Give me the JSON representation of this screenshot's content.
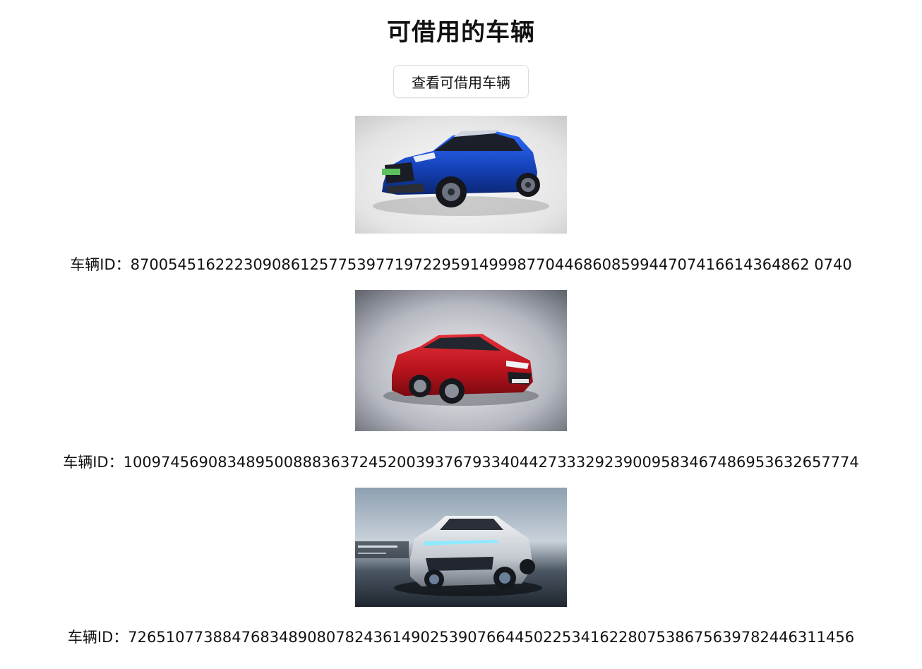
{
  "header": {
    "title": "可借用的车辆",
    "view_button_label": "查看可借用车辆"
  },
  "vehicles": [
    {
      "id_label": "车辆ID：870054516222309086125775397719722959149998770446860859944707416614364862 0740",
      "color": "#1740b8",
      "type": "suv",
      "image_name": "blue-suv-image"
    },
    {
      "id_label": "车辆ID：100974569083489500888363724520039376793340442733329239009583467486953632657774",
      "color": "#c0151f",
      "type": "sedan",
      "image_name": "red-sedan-image"
    },
    {
      "id_label": "车辆ID：72651077388476834890807824361490253907664450225341622807538675639782446311456",
      "color": "#c8ccd2",
      "type": "suv",
      "image_name": "silver-suv-image"
    }
  ]
}
